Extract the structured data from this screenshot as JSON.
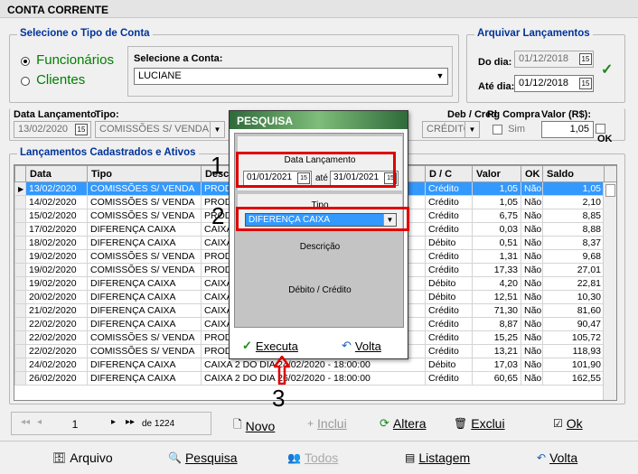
{
  "window": {
    "title": "CONTA CORRENTE"
  },
  "tipo_conta": {
    "title": "Selecione o Tipo de Conta",
    "opt1": "Funcionários",
    "opt2": "Clientes",
    "conta_label": "Selecione a Conta:",
    "conta_value": "LUCIANE"
  },
  "arquivar": {
    "title": "Arquivar Lançamentos",
    "do_dia_label": "Do dia:",
    "do_dia_value": "01/12/2018",
    "ate_dia_label": "Até dia:",
    "ate_dia_value": "01/12/2018"
  },
  "entry": {
    "data_label": "Data Lançamento:",
    "data_value": "13/02/2020",
    "tipo_label": "Tipo:",
    "tipo_value": "COMISSÕES S/ VENDA",
    "debcred_label": "Deb / Cred",
    "debcred_value": "CRÉDITO",
    "pgcompra_label": "Pg Compra",
    "sim_label": "Sim",
    "valor_label": "Valor (R$):",
    "valor_value": "1,05",
    "ok_label": "OK"
  },
  "grid": {
    "title": "Lançamentos Cadastrados e Ativos",
    "headers": {
      "data": "Data",
      "tipo": "Tipo",
      "descr": "Descri",
      "dc": "D / C",
      "valor": "Valor",
      "ok": "OK",
      "saldo": "Saldo"
    },
    "rows": [
      {
        "data": "13/02/2020",
        "tipo": "COMISSÕES S/ VENDA",
        "descr": "PRODU",
        "dc": "Crédito",
        "valor": "1,05",
        "ok": "Não",
        "saldo": "1,05"
      },
      {
        "data": "14/02/2020",
        "tipo": "COMISSÕES S/ VENDA",
        "descr": "PRODU",
        "dc": "Crédito",
        "valor": "1,05",
        "ok": "Não",
        "saldo": "2,10"
      },
      {
        "data": "15/02/2020",
        "tipo": "COMISSÕES S/ VENDA",
        "descr": "PRODU",
        "dc": "Crédito",
        "valor": "6,75",
        "ok": "Não",
        "saldo": "8,85"
      },
      {
        "data": "17/02/2020",
        "tipo": "DIFERENÇA CAIXA",
        "descr": "CAIXA",
        "dc": "Crédito",
        "valor": "0,03",
        "ok": "Não",
        "saldo": "8,88"
      },
      {
        "data": "18/02/2020",
        "tipo": "DIFERENÇA CAIXA",
        "descr": "CAIXA",
        "dc": "Débito",
        "valor": "0,51",
        "ok": "Não",
        "saldo": "8,37"
      },
      {
        "data": "19/02/2020",
        "tipo": "COMISSÕES S/ VENDA",
        "descr": "PRODU",
        "dc": "Crédito",
        "valor": "1,31",
        "ok": "Não",
        "saldo": "9,68"
      },
      {
        "data": "19/02/2020",
        "tipo": "COMISSÕES S/ VENDA",
        "descr": "PRODU",
        "dc": "Crédito",
        "valor": "17,33",
        "ok": "Não",
        "saldo": "27,01"
      },
      {
        "data": "19/02/2020",
        "tipo": "DIFERENÇA CAIXA",
        "descr": "CAIXA",
        "dc": "Débito",
        "valor": "4,20",
        "ok": "Não",
        "saldo": "22,81"
      },
      {
        "data": "20/02/2020",
        "tipo": "DIFERENÇA CAIXA",
        "descr": "CAIXA",
        "dc": "Débito",
        "valor": "12,51",
        "ok": "Não",
        "saldo": "10,30"
      },
      {
        "data": "21/02/2020",
        "tipo": "DIFERENÇA CAIXA",
        "descr": "CAIXA",
        "dc": "Crédito",
        "valor": "71,30",
        "ok": "Não",
        "saldo": "81,60"
      },
      {
        "data": "22/02/2020",
        "tipo": "DIFERENÇA CAIXA",
        "descr": "CAIXA",
        "dc": "Crédito",
        "valor": "8,87",
        "ok": "Não",
        "saldo": "90,47"
      },
      {
        "data": "22/02/2020",
        "tipo": "COMISSÕES S/ VENDA",
        "descr": "PRODU",
        "dc": "Crédito",
        "valor": "15,25",
        "ok": "Não",
        "saldo": "105,72"
      },
      {
        "data": "22/02/2020",
        "tipo": "COMISSÕES S/ VENDA",
        "descr": "PRODU",
        "dc": "Crédito",
        "valor": "13,21",
        "ok": "Não",
        "saldo": "118,93"
      },
      {
        "data": "24/02/2020",
        "tipo": "DIFERENÇA CAIXA",
        "descr": "CAIXA 2 DO DIA 24/02/2020 - 18:00:00",
        "dc": "Débito",
        "valor": "17,03",
        "ok": "Não",
        "saldo": "101,90"
      },
      {
        "data": "26/02/2020",
        "tipo": "DIFERENÇA CAIXA",
        "descr": "CAIXA 2 DO DIA 26/02/2020 - 18:00:00",
        "dc": "Crédito",
        "valor": "60,65",
        "ok": "Não",
        "saldo": "162,55"
      }
    ]
  },
  "nav": {
    "page": "1",
    "of": "de 1224"
  },
  "actions": {
    "novo": "Novo",
    "inclui": "Inclui",
    "altera": "Altera",
    "exclui": "Exclui",
    "ok": "Ok"
  },
  "toolbar": {
    "arquivo": "Arquivo",
    "pesquisa": "Pesquisa",
    "todos": "Todos",
    "listagem": "Listagem",
    "volta": "Volta"
  },
  "dialog": {
    "title": "PESQUISA",
    "data_label": "Data Lançamento",
    "from": "01/01/2021",
    "ate": "até",
    "to": "31/01/2021",
    "tipo_label": "Tipo",
    "tipo_value": "DIFERENÇA CAIXA",
    "descricao_label": "Descrição",
    "debcred_label": "Débito / Crédito",
    "executa": "Executa",
    "volta": "Volta"
  },
  "annotations": {
    "n1": "1",
    "n2": "2",
    "n3": "3"
  },
  "colors": {
    "accent": "#003399",
    "selection": "#3399ff",
    "highlight": "#e00000",
    "radio_label": "#008000"
  }
}
